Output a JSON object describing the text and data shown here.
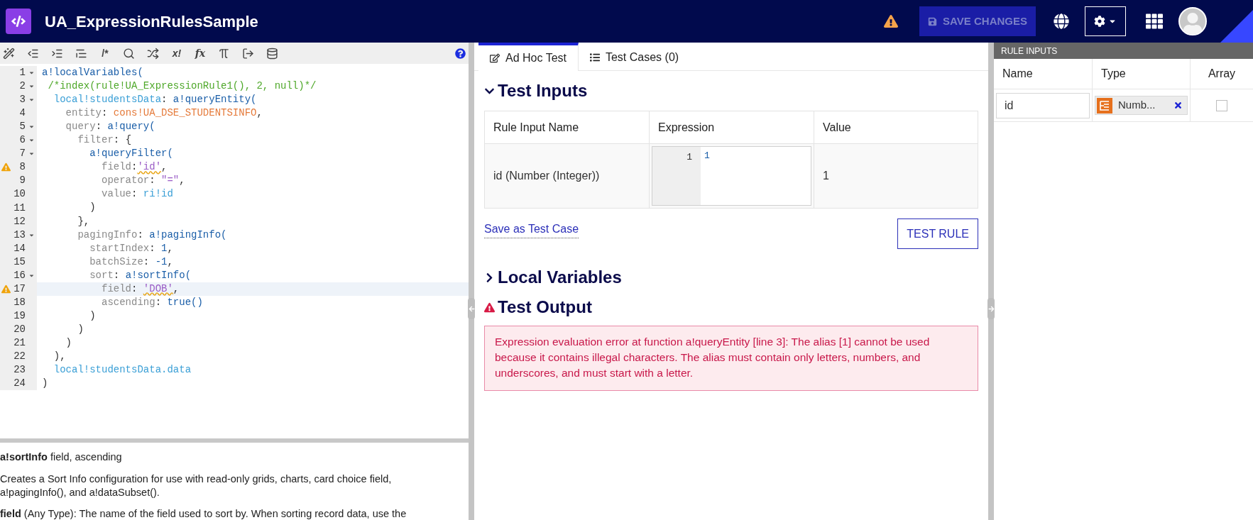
{
  "header": {
    "title": "UA_ExpressionRulesSample",
    "save_button": {
      "label": "SAVE CHANGES",
      "disabled": true
    }
  },
  "toolbar_glyphs": [
    "/*",
    "x!",
    "fx"
  ],
  "code_lines": [
    {
      "number": "1",
      "fold": true,
      "warning": false,
      "current": false,
      "segments": [
        {
          "t": "a!localVariables(",
          "kind": "fn"
        }
      ]
    },
    {
      "number": "2",
      "fold": true,
      "warning": false,
      "current": false,
      "segments": [
        {
          "t": " /*index(rule!UA_ExpressionRule1(), 2, null)*/",
          "kind": "comment"
        }
      ]
    },
    {
      "number": "3",
      "fold": true,
      "warning": false,
      "current": false,
      "segments": [
        {
          "t": "  local!studentsData",
          "kind": "local"
        },
        {
          "t": ": ",
          "kind": "plain"
        },
        {
          "t": "a!queryEntity(",
          "kind": "fn"
        }
      ]
    },
    {
      "number": "4",
      "fold": false,
      "warning": false,
      "current": false,
      "segments": [
        {
          "t": "    entity",
          "kind": "key"
        },
        {
          "t": ": ",
          "kind": "plain"
        },
        {
          "t": "cons!UA_DSE_STUDENTSINFO",
          "kind": "const"
        },
        {
          "t": ",",
          "kind": "plain"
        }
      ]
    },
    {
      "number": "5",
      "fold": true,
      "warning": false,
      "current": false,
      "segments": [
        {
          "t": "    query",
          "kind": "key"
        },
        {
          "t": ": ",
          "kind": "plain"
        },
        {
          "t": "a!query(",
          "kind": "fn"
        }
      ]
    },
    {
      "number": "6",
      "fold": true,
      "warning": false,
      "current": false,
      "segments": [
        {
          "t": "      filter",
          "kind": "key"
        },
        {
          "t": ": {",
          "kind": "plain"
        }
      ]
    },
    {
      "number": "7",
      "fold": true,
      "warning": false,
      "current": false,
      "segments": [
        {
          "t": "        a!queryFilter(",
          "kind": "fn"
        }
      ]
    },
    {
      "number": "8",
      "fold": false,
      "warning": true,
      "current": false,
      "segments": [
        {
          "t": "          field",
          "kind": "key"
        },
        {
          "t": ":",
          "kind": "plain"
        },
        {
          "t": "'id'",
          "kind": "string",
          "squiggle": true
        },
        {
          "t": ",",
          "kind": "plain"
        }
      ]
    },
    {
      "number": "9",
      "fold": false,
      "warning": false,
      "current": false,
      "segments": [
        {
          "t": "          operator",
          "kind": "key"
        },
        {
          "t": ": ",
          "kind": "plain"
        },
        {
          "t": "\"=\"",
          "kind": "string"
        },
        {
          "t": ",",
          "kind": "plain"
        }
      ]
    },
    {
      "number": "10",
      "fold": false,
      "warning": false,
      "current": false,
      "segments": [
        {
          "t": "          value",
          "kind": "key"
        },
        {
          "t": ": ",
          "kind": "plain"
        },
        {
          "t": "ri!id",
          "kind": "local"
        }
      ]
    },
    {
      "number": "11",
      "fold": false,
      "warning": false,
      "current": false,
      "segments": [
        {
          "t": "        )",
          "kind": "plain"
        }
      ]
    },
    {
      "number": "12",
      "fold": false,
      "warning": false,
      "current": false,
      "segments": [
        {
          "t": "      },",
          "kind": "plain"
        }
      ]
    },
    {
      "number": "13",
      "fold": true,
      "warning": false,
      "current": false,
      "segments": [
        {
          "t": "      pagingInfo",
          "kind": "key"
        },
        {
          "t": ": ",
          "kind": "plain"
        },
        {
          "t": "a!pagingInfo(",
          "kind": "fn"
        }
      ]
    },
    {
      "number": "14",
      "fold": false,
      "warning": false,
      "current": false,
      "segments": [
        {
          "t": "        startIndex",
          "kind": "key"
        },
        {
          "t": ": ",
          "kind": "plain"
        },
        {
          "t": "1",
          "kind": "number"
        },
        {
          "t": ",",
          "kind": "plain"
        }
      ]
    },
    {
      "number": "15",
      "fold": false,
      "warning": false,
      "current": false,
      "segments": [
        {
          "t": "        batchSize",
          "kind": "key"
        },
        {
          "t": ": ",
          "kind": "plain"
        },
        {
          "t": "-1",
          "kind": "number"
        },
        {
          "t": ",",
          "kind": "plain"
        }
      ]
    },
    {
      "number": "16",
      "fold": true,
      "warning": false,
      "current": false,
      "segments": [
        {
          "t": "        sort",
          "kind": "key"
        },
        {
          "t": ": ",
          "kind": "plain"
        },
        {
          "t": "a!sortInfo(",
          "kind": "fn"
        }
      ]
    },
    {
      "number": "17",
      "fold": false,
      "warning": true,
      "current": true,
      "segments": [
        {
          "t": "          field",
          "kind": "key"
        },
        {
          "t": ": ",
          "kind": "plain"
        },
        {
          "t": "'DOB'",
          "kind": "string",
          "squiggle": true
        },
        {
          "t": ",",
          "kind": "plain"
        }
      ]
    },
    {
      "number": "18",
      "fold": false,
      "warning": false,
      "current": false,
      "segments": [
        {
          "t": "          ascending",
          "kind": "key"
        },
        {
          "t": ": ",
          "kind": "plain"
        },
        {
          "t": "true()",
          "kind": "fn"
        }
      ]
    },
    {
      "number": "19",
      "fold": false,
      "warning": false,
      "current": false,
      "segments": [
        {
          "t": "        )",
          "kind": "plain"
        }
      ]
    },
    {
      "number": "20",
      "fold": false,
      "warning": false,
      "current": false,
      "segments": [
        {
          "t": "      )",
          "kind": "plain"
        }
      ]
    },
    {
      "number": "21",
      "fold": false,
      "warning": false,
      "current": false,
      "segments": [
        {
          "t": "    )",
          "kind": "plain"
        }
      ]
    },
    {
      "number": "22",
      "fold": false,
      "warning": false,
      "current": false,
      "segments": [
        {
          "t": "  ),",
          "kind": "plain"
        }
      ]
    },
    {
      "number": "23",
      "fold": false,
      "warning": false,
      "current": false,
      "segments": [
        {
          "t": "  local!studentsData.data",
          "kind": "local"
        }
      ]
    },
    {
      "number": "24",
      "fold": false,
      "warning": false,
      "current": false,
      "segments": [
        {
          "t": ")",
          "kind": "plain"
        }
      ]
    }
  ],
  "doc": {
    "signature": "**a!sortInfo**  field, ascending",
    "description": "Creates a Sort Info configuration for use with read-only grids, charts, card choice field, a!pagingInfo(), and a!dataSubset().",
    "param": "**field** (Any Type): The name of the field used to sort by. When sorting record data, use the"
  },
  "tabs": [
    {
      "label": "Ad Hoc Test",
      "selected": true
    },
    {
      "label": "Test Cases (0)",
      "selected": false
    }
  ],
  "test_inputs": {
    "title": "Test Inputs",
    "expanded": true,
    "columns": [
      "Rule Input Name",
      "Expression",
      "Value"
    ],
    "rows": [
      {
        "name": "id (Number (Integer))",
        "expression_line": "1",
        "expression": "1",
        "value": "1"
      }
    ],
    "save_link": "Save as Test Case",
    "test_button": "TEST RULE"
  },
  "local_variables": {
    "title": "Local Variables",
    "expanded": false
  },
  "test_output": {
    "title": "Test Output",
    "error": true,
    "message": "Expression evaluation error at function a!queryEntity [line 3]: The alias [1] cannot be used because it contains illegal characters.  The alias must contain only letters, numbers, and underscores, and must start with a letter."
  },
  "rule_inputs": {
    "title": "RULE INPUTS",
    "columns": [
      "Name",
      "Type",
      "Array"
    ],
    "rows": [
      {
        "name": "id",
        "type": "Numb...",
        "array": false
      }
    ]
  }
}
